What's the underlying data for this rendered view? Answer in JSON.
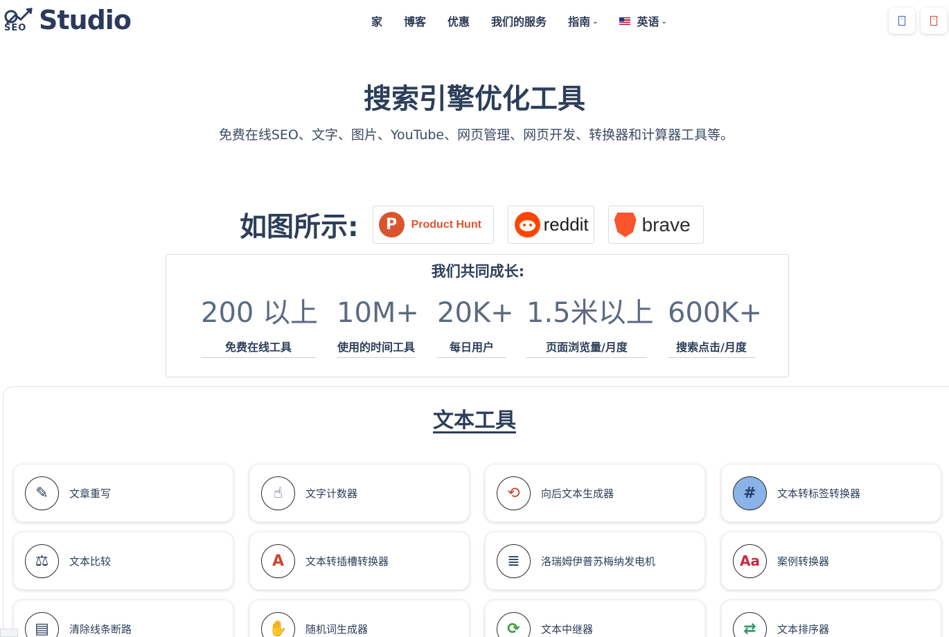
{
  "brand": {
    "logo_small": "SEO",
    "logo_word": "Studio"
  },
  "nav": {
    "items": [
      "家",
      "博客",
      "优惠",
      "我们的服务",
      "指南"
    ],
    "language": "英语"
  },
  "hero": {
    "title": "搜索引擎优化工具",
    "subtitle": "免费在线SEO、文字、图片、YouTube、网页管理、网页开发、转换器和计算器工具等。"
  },
  "as_seen": {
    "label": "如图所示:",
    "badges": {
      "producthunt": "Product Hunt",
      "producthunt_letter": "P",
      "reddit": "reddit",
      "brave": "brave"
    }
  },
  "stats": {
    "title": "我们共同成长:",
    "items": [
      {
        "value": "200 以上",
        "label": "免费在线工具"
      },
      {
        "value": "10M+",
        "label": "使用的时间工具"
      },
      {
        "value": "20K+",
        "label": "每日用户"
      },
      {
        "value": "1.5米以上",
        "label": "页面浏览量/月度"
      },
      {
        "value": "600K+",
        "label": "搜索点击/月度"
      }
    ]
  },
  "text_tools": {
    "title": "文本工具",
    "cards": [
      {
        "label": "文章重写",
        "icon": "article-rewrite-icon",
        "glyph": "✎"
      },
      {
        "label": "文字计数器",
        "icon": "word-counter-icon",
        "glyph": "☝"
      },
      {
        "label": "向后文本生成器",
        "icon": "backwards-text-icon",
        "glyph": "⟲"
      },
      {
        "label": "文本转标签转换器",
        "icon": "hashtag-icon",
        "glyph": "#"
      },
      {
        "label": "文本比较",
        "icon": "text-compare-icon",
        "glyph": "⚖"
      },
      {
        "label": "文本转插槽转换器",
        "icon": "text-slug-icon",
        "glyph": "A"
      },
      {
        "label": "洛瑞姆伊普苏梅纳发电机",
        "icon": "lorem-ipsum-icon",
        "glyph": "≣"
      },
      {
        "label": "案例转换器",
        "icon": "case-converter-icon",
        "glyph": "Aa"
      },
      {
        "label": "清除线条断路",
        "icon": "clipboard-icon",
        "glyph": "▤"
      },
      {
        "label": "随机词生成器",
        "icon": "random-word-icon",
        "glyph": "✋"
      },
      {
        "label": "文本中继器",
        "icon": "repeat-icon",
        "glyph": "⟳"
      },
      {
        "label": "文本排序器",
        "icon": "sort-arrows-icon",
        "glyph": "⇄"
      }
    ]
  },
  "colors": {
    "primary_text": "#2c3e5a",
    "producthunt": "#da552f",
    "reddit": "#ff4500",
    "brave": "#fb542b"
  }
}
